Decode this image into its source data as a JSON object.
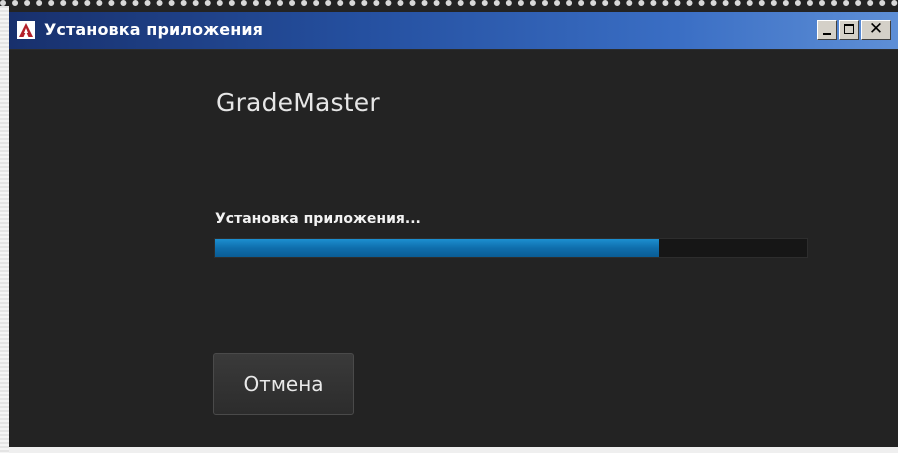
{
  "window": {
    "title": "Установка приложения",
    "icon": "air-installer-icon",
    "controls": {
      "minimize": "minimize-icon",
      "maximize": "maximize-icon",
      "close": "✕"
    }
  },
  "main": {
    "app_name": "GradeMaster",
    "status_text": "Установка приложения...",
    "progress": 0.75,
    "cancel_label": "Отмена"
  },
  "colors": {
    "background": "#232323",
    "titlebar": "#2550a0",
    "progress_fill": "#0f6eac",
    "text": "#e6e6e6"
  }
}
